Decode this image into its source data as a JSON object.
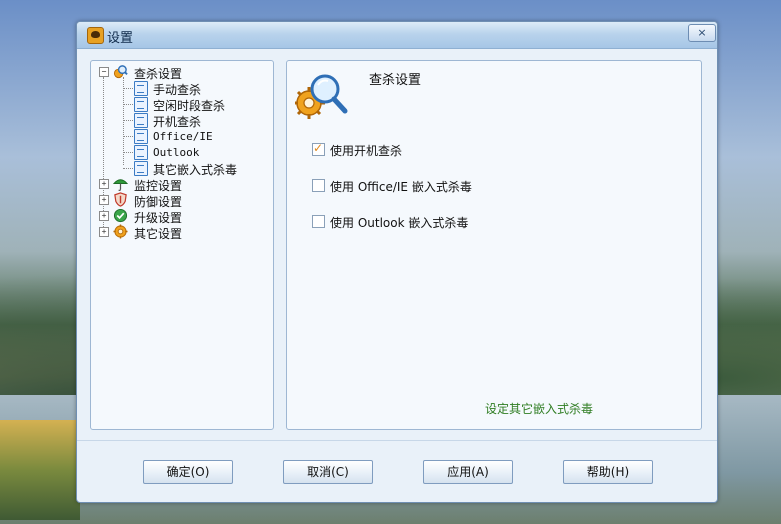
{
  "window": {
    "title": "设置",
    "close_label": "×"
  },
  "tree": {
    "items": [
      {
        "label": "查杀设置",
        "expander": "−",
        "icon": "magnifier-gear-icon"
      },
      {
        "label": "手动查杀",
        "icon": "document-icon"
      },
      {
        "label": "空闲时段查杀",
        "icon": "document-icon"
      },
      {
        "label": "开机查杀",
        "icon": "document-icon"
      },
      {
        "label": "Office/IE",
        "icon": "document-icon"
      },
      {
        "label": "Outlook",
        "icon": "document-icon"
      },
      {
        "label": "其它嵌入式杀毒",
        "icon": "document-icon"
      },
      {
        "label": "监控设置",
        "expander": "+",
        "icon": "umbrella-icon"
      },
      {
        "label": "防御设置",
        "expander": "+",
        "icon": "shield-icon"
      },
      {
        "label": "升级设置",
        "expander": "+",
        "icon": "globe-check-icon"
      },
      {
        "label": "其它设置",
        "expander": "+",
        "icon": "gear-icon"
      }
    ]
  },
  "content": {
    "title": "查杀设置",
    "options": [
      {
        "label": "使用开机查杀",
        "checked": true
      },
      {
        "label": "使用 Office/IE 嵌入式杀毒",
        "checked": false
      },
      {
        "label": "使用 Outlook 嵌入式杀毒",
        "checked": false
      }
    ],
    "link": "设定其它嵌入式杀毒"
  },
  "buttons": {
    "ok": "确定(O)",
    "cancel": "取消(C)",
    "apply": "应用(A)",
    "help": "帮助(H)"
  }
}
